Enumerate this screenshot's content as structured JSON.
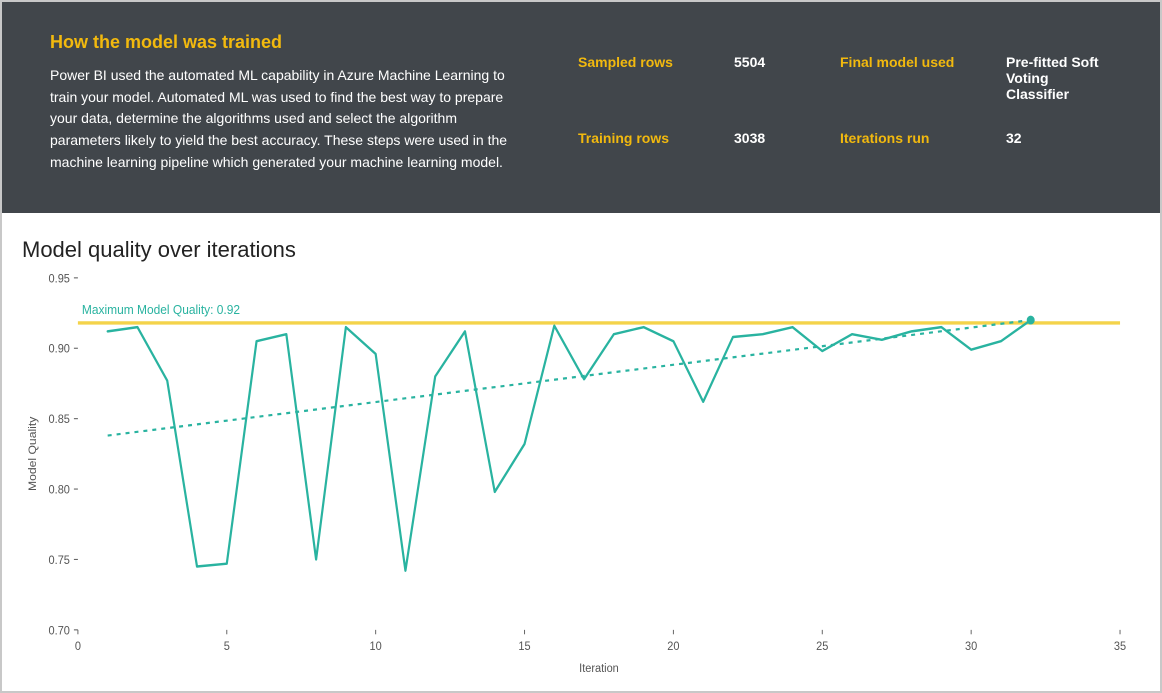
{
  "header": {
    "title": "How the model was trained",
    "description": "Power BI used the automated ML capability in Azure Machine Learning to train your model. Automated ML was used to find the best way to prepare your data, determine the algorithms used and select the algorithm parameters likely to yield the best accuracy. These steps were used in the machine learning pipeline which generated your machine learning model.",
    "stats": {
      "sampled_rows_label": "Sampled rows",
      "sampled_rows_value": "5504",
      "final_model_label": "Final model used",
      "final_model_value": "Pre-fitted Soft Voting Classifier",
      "training_rows_label": "Training rows",
      "training_rows_value": "3038",
      "iterations_run_label": "Iterations run",
      "iterations_run_value": "32"
    }
  },
  "chart": {
    "title": "Model quality over iterations",
    "xlabel": "Iteration",
    "ylabel": "Model Quality",
    "annotation": "Maximum Model Quality: 0.92",
    "y_ticks": [
      0.7,
      0.75,
      0.8,
      0.85,
      0.9,
      0.95
    ],
    "x_ticks": [
      0,
      5,
      10,
      15,
      20,
      25,
      30,
      35
    ],
    "max_line_y": 0.918,
    "colors": {
      "series": "#29b3a0",
      "trend": "#29b3a0",
      "max_line": "#f4d34a",
      "axis": "#666666"
    }
  },
  "chart_data": {
    "type": "line",
    "title": "Model quality over iterations",
    "xlabel": "Iteration",
    "ylabel": "Model Quality",
    "ylim": [
      0.7,
      0.95
    ],
    "x": [
      1,
      2,
      3,
      4,
      5,
      6,
      7,
      8,
      9,
      10,
      11,
      12,
      13,
      14,
      15,
      16,
      17,
      18,
      19,
      20,
      21,
      22,
      23,
      24,
      25,
      26,
      27,
      28,
      29,
      30,
      31,
      32
    ],
    "series": [
      {
        "name": "Model Quality",
        "values": [
          0.912,
          0.915,
          0.877,
          0.745,
          0.747,
          0.905,
          0.91,
          0.75,
          0.915,
          0.896,
          0.742,
          0.88,
          0.912,
          0.798,
          0.832,
          0.916,
          0.878,
          0.91,
          0.915,
          0.905,
          0.862,
          0.908,
          0.91,
          0.915,
          0.898,
          0.91,
          0.906,
          0.912,
          0.915,
          0.899,
          0.905,
          0.92
        ]
      }
    ],
    "trend_line": {
      "x": [
        1,
        32
      ],
      "y": [
        0.838,
        0.92
      ]
    },
    "reference_lines": [
      {
        "label": "Maximum Model Quality: 0.92",
        "y": 0.918
      }
    ]
  }
}
